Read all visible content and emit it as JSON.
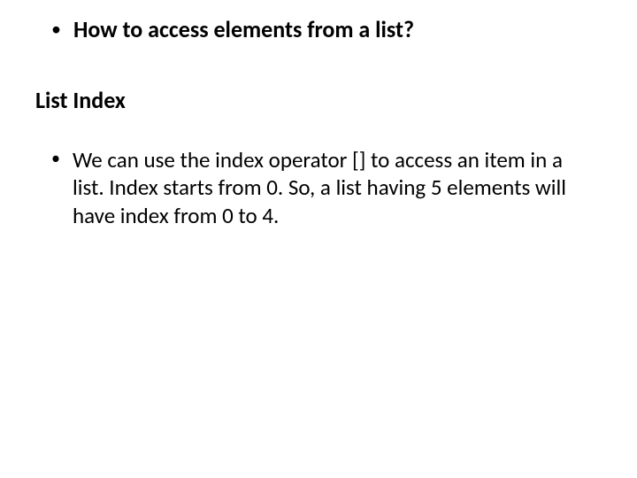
{
  "heading": "How to access elements from a list?",
  "subheading": "List Index",
  "body": "We can use the index operator [] to access an item in a list. Index starts from 0. So, a list having 5 elements will have index from 0 to 4."
}
